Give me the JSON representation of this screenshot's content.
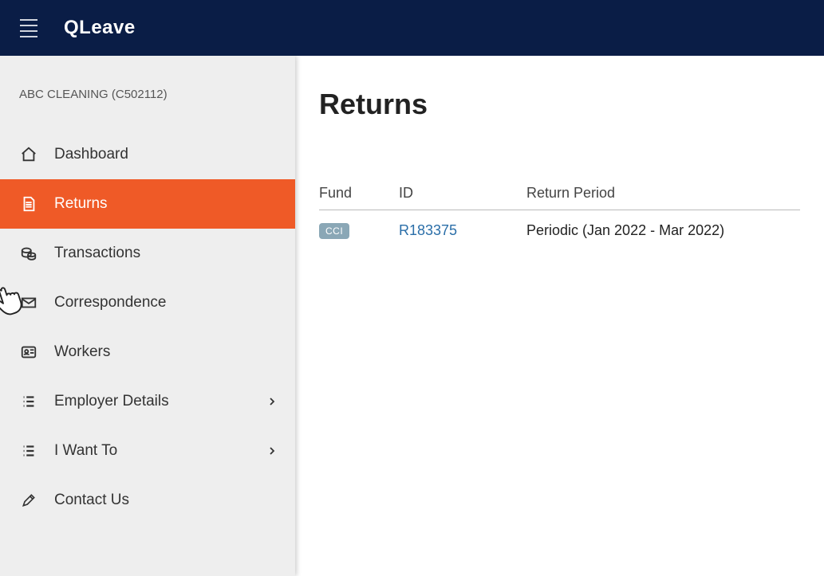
{
  "app": {
    "title": "QLeave"
  },
  "sidebar": {
    "org_label": "ABC CLEANING (C502112)",
    "items": [
      {
        "label": "Dashboard",
        "icon": "home",
        "expandable": false,
        "active": false
      },
      {
        "label": "Returns",
        "icon": "calendar-doc",
        "expandable": false,
        "active": true
      },
      {
        "label": "Transactions",
        "icon": "coins",
        "expandable": false,
        "active": false
      },
      {
        "label": "Correspondence",
        "icon": "envelope",
        "expandable": false,
        "active": false
      },
      {
        "label": "Workers",
        "icon": "id-card",
        "expandable": false,
        "active": false
      },
      {
        "label": "Employer Details",
        "icon": "list",
        "expandable": true,
        "active": false
      },
      {
        "label": "I Want To",
        "icon": "list",
        "expandable": true,
        "active": false
      },
      {
        "label": "Contact Us",
        "icon": "pencil",
        "expandable": false,
        "active": false
      }
    ]
  },
  "page": {
    "title": "Returns",
    "columns": {
      "fund": "Fund",
      "id": "ID",
      "period": "Return Period"
    },
    "rows": [
      {
        "fund": "CCI",
        "id": "R183375",
        "period": "Periodic (Jan 2022 - Mar 2022)"
      }
    ]
  }
}
